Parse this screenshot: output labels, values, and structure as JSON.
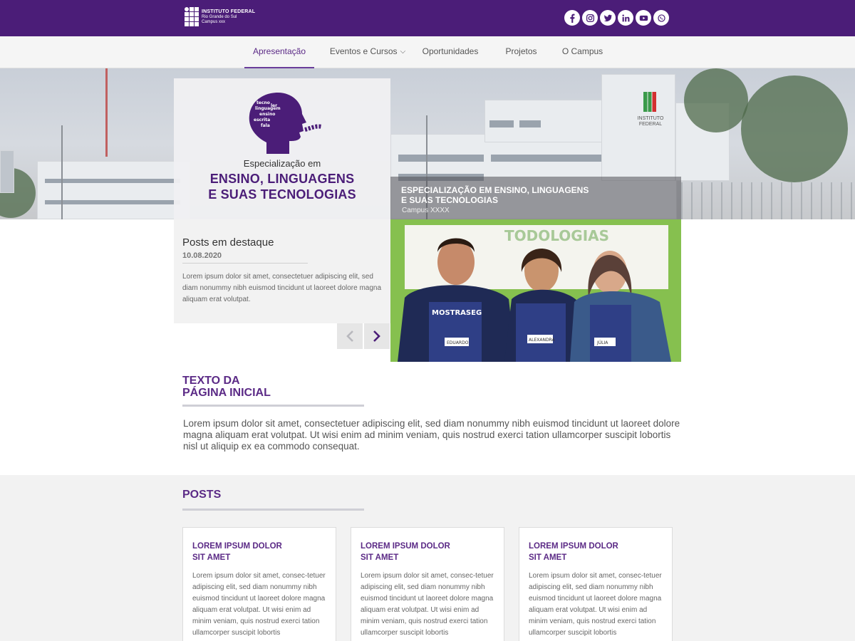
{
  "header": {
    "logo": {
      "line1": "INSTITUTO FEDERAL",
      "line2": "Rio Grande do Sul",
      "line3": "Campus xxx"
    },
    "social_icons": [
      "facebook-icon",
      "instagram-icon",
      "twitter-icon",
      "linkedin-icon",
      "youtube-icon",
      "whatsapp-icon"
    ]
  },
  "nav": {
    "items": [
      {
        "label": "Apresentação",
        "active": true
      },
      {
        "label": "Eventos e Cursos",
        "has_dropdown": true
      },
      {
        "label": "Oportunidades"
      },
      {
        "label": "Projetos"
      },
      {
        "label": "O Campus"
      }
    ]
  },
  "hero": {
    "card_subtitle": "Especialização em",
    "card_title_line1": "ENSINO, LINGUAGENS",
    "card_title_line2": "E SUAS TECNOLOGIAS",
    "building_sign_line1": "INSTITUTO",
    "building_sign_line2": "FEDERAL",
    "caption_title_line1": "ESPECIALIZAÇÃO EM ENSINO, LINGUAGENS",
    "caption_title_line2": "E SUAS TECNOLOGIAS",
    "caption_campus": "Campus XXXX"
  },
  "featured": {
    "title": "Posts em destaque",
    "date": "10.08.2020",
    "text": "Lorem ipsum dolor sit amet, consectetuer adipiscing elit, sed diam nonummy nibh euismod tincidunt ut laoreet dolore magna aliquam erat volutpat."
  },
  "photo": {
    "banner": "TODOLOGIAS",
    "badge_names": [
      "EDUARDO",
      "ALEXANDRA",
      "JÚLIA"
    ],
    "shirt_text": "MOSTRASEG"
  },
  "intro": {
    "title_line1": "TEXTO DA",
    "title_line2": "PÁGINA INICIAL",
    "text": "Lorem ipsum dolor sit amet, consectetuer adipiscing elit, sed diam nonummy nibh euismod tincidunt ut laoreet dolore magna aliquam erat volutpat. Ut wisi enim ad minim veniam, quis nostrud exerci tation ullamcorper suscipit lobortis nisl ut aliquip ex ea commodo consequat."
  },
  "posts": {
    "title": "POSTS",
    "cards": [
      {
        "title_line1": "LOREM IPSUM DOLOR",
        "title_line2": "SIT AMET",
        "text": "Lorem ipsum dolor sit amet, consec-tetuer adipiscing elit, sed diam nonummy nibh euismod tincidunt ut laoreet dolore magna aliquam erat volutpat. Ut wisi enim ad minim veniam, quis nostrud exerci tation ullamcorper suscipit lobortis"
      },
      {
        "title_line1": "LOREM IPSUM DOLOR",
        "title_line2": "SIT AMET",
        "text": "Lorem ipsum dolor sit amet, consec-tetuer adipiscing elit, sed diam nonummy nibh euismod tincidunt ut laoreet dolore magna aliquam erat volutpat. Ut wisi enim ad minim veniam, quis nostrud exerci tation ullamcorper suscipit lobortis"
      },
      {
        "title_line1": "LOREM IPSUM DOLOR",
        "title_line2": "SIT AMET",
        "text": "Lorem ipsum dolor sit amet, consec-tetuer adipiscing elit, sed diam nonummy nibh euismod tincidunt ut laoreet dolore magna aliquam erat volutpat. Ut wisi enim ad minim veniam, quis nostrud exerci tation ullamcorper suscipit lobortis"
      }
    ]
  },
  "colors": {
    "brand_purple": "#4b1d78",
    "accent_purple": "#5b2a86",
    "rule_gray": "#cfcfd6",
    "section_bg": "#f2f2f2"
  }
}
